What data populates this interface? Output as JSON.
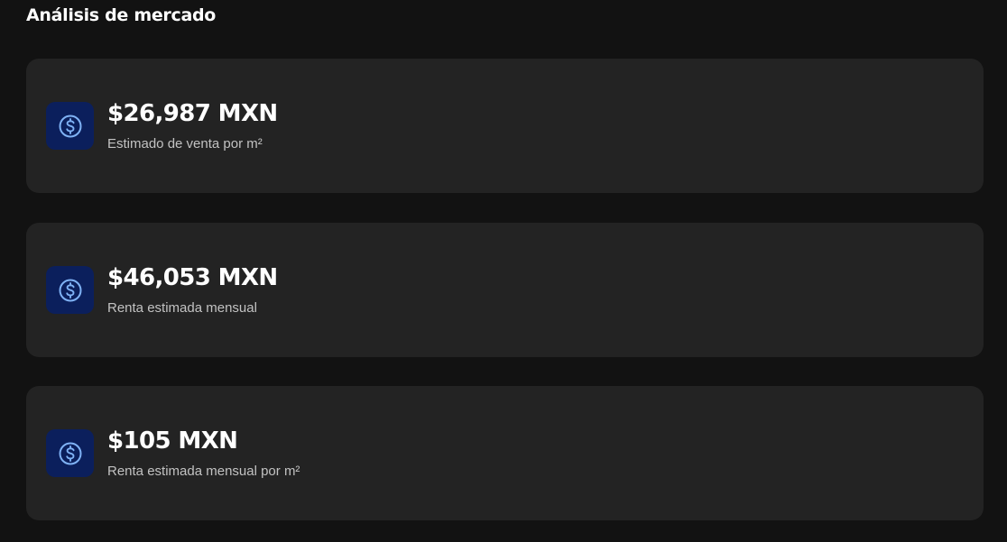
{
  "section": {
    "title": "Análisis de mercado"
  },
  "cards": [
    {
      "value": "$26,987 MXN",
      "label": "Estimado de venta por m²",
      "icon": "dollar-circle-icon"
    },
    {
      "value": "$46,053 MXN",
      "label": "Renta estimada mensual",
      "icon": "dollar-circle-icon"
    },
    {
      "value": "$105 MXN",
      "label": "Renta estimada mensual por m²",
      "icon": "dollar-circle-icon"
    }
  ],
  "colors": {
    "background": "#121212",
    "card": "#232323",
    "icon_tile": "#0b1f5c",
    "icon_stroke": "#7fb2f5",
    "value_text": "#ffffff",
    "label_text": "#c2c2c2"
  }
}
